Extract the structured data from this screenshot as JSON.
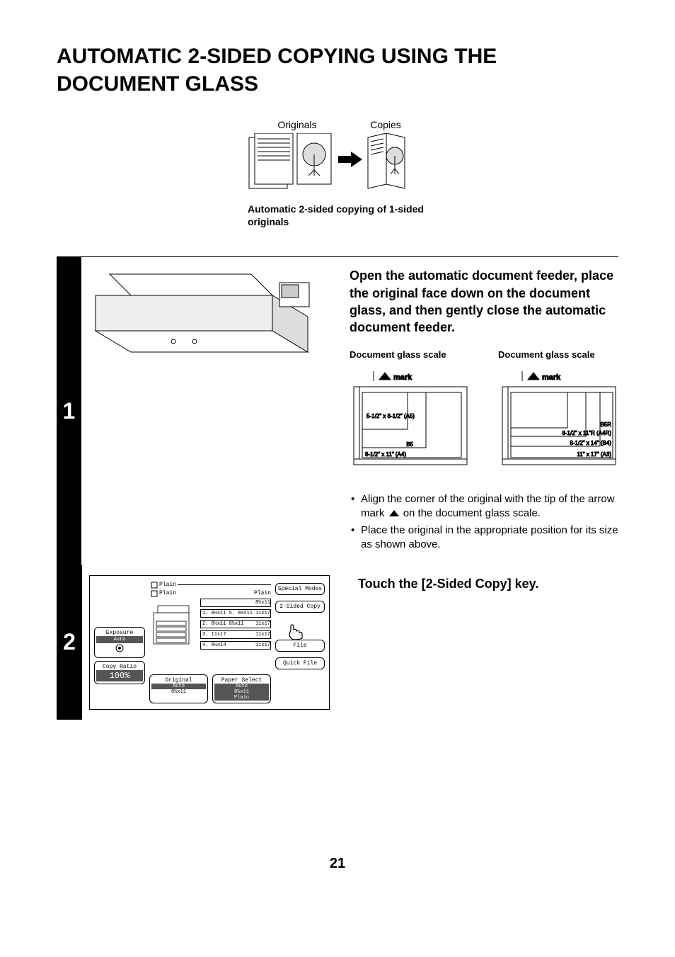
{
  "title": "AUTOMATIC 2-SIDED COPYING USING THE DOCUMENT GLASS",
  "intro": {
    "originals_label": "Originals",
    "copies_label": "Copies",
    "caption": "Automatic 2-sided copying of 1-sided originals"
  },
  "step1": {
    "number": "1",
    "heading": "Open the automatic document feeder, place the original face down on the document glass, and then gently close the automatic document feeder.",
    "glass_label": "Document glass scale",
    "mark_label": "mark",
    "sizes_left": {
      "a5": "5-1/2\" x 8-1/2\" (A5)",
      "b5": "B5",
      "a4": "8-1/2\" x 11\" (A4)"
    },
    "sizes_right": {
      "b5r": "B5R",
      "a4r": "8-1/2\" x 11\"R (A4R)",
      "b4": "8-1/2\" x 14\" (B4)",
      "a3": "11\" x 17\" (A3)"
    },
    "bullet1a": "Align the corner of the original with the tip of the arrow mark",
    "bullet1b": "on the document glass scale.",
    "bullet2": "Place the original in the appropriate position for its size as shown above."
  },
  "step2": {
    "number": "2",
    "heading": "Touch the [2-Sided Copy] key.",
    "panel": {
      "tray_label": "Plain",
      "tray_size1": "8½x11",
      "tray_size2": "11x17",
      "tray_size3": "11x17",
      "tray_size4": "11x17",
      "tray_size5": "8½x14",
      "exposure": "Exposure",
      "auto": "Auto",
      "copy_ratio": "Copy Ratio",
      "ratio_val": "100%",
      "original": "Original",
      "orig_size": "8½x11",
      "paper_select": "Paper Select",
      "paper_val": "8½x11",
      "paper_type": "Plain",
      "special_modes": "Special Modes",
      "two_sided": "2-Sided Copy",
      "file": "File",
      "quick_file": "Quick File"
    }
  },
  "page_number": "21"
}
